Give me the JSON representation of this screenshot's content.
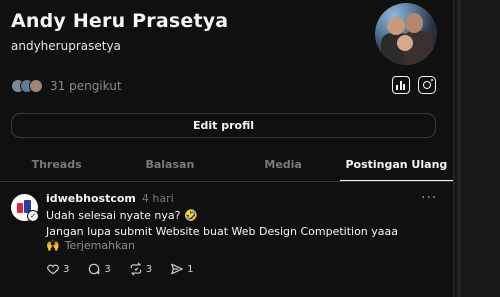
{
  "profile": {
    "name": "Andy Heru Prasetya",
    "handle": "andyheruprasetya",
    "followers_text": "31 pengikut",
    "edit_button": "Edit profil"
  },
  "icons": {
    "insights": "bar-chart-icon",
    "instagram": "instagram-icon"
  },
  "tabs": [
    {
      "label": "Threads",
      "active": false
    },
    {
      "label": "Balasan",
      "active": false
    },
    {
      "label": "Media",
      "active": false
    },
    {
      "label": "Postingan Ulang",
      "active": true
    }
  ],
  "post": {
    "author": "idwebhostcom",
    "time": "4 hari",
    "more": "···",
    "line1": "Udah selesai nyate nya? 🤣",
    "line2": "Jangan lupa submit Website buat Web Design Competition yaaa",
    "emoji": "🙌",
    "translate": "Terjemahkan",
    "likes": "3",
    "comments": "3",
    "reposts": "3",
    "shares": "1"
  }
}
